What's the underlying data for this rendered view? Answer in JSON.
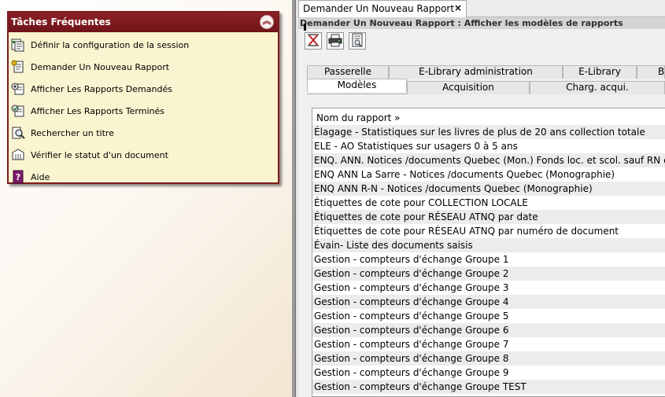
{
  "tasks_panel": {
    "title": "Tâches Fréquentes",
    "collapse_glyph": "︽",
    "items": [
      {
        "label": "Définir la configuration de la session",
        "icon": "session-config-icon"
      },
      {
        "label": "Demander Un Nouveau Rapport",
        "icon": "new-report-icon"
      },
      {
        "label": "Afficher Les Rapports Demandés",
        "icon": "requested-reports-icon"
      },
      {
        "label": "Afficher Les Rapports Terminés",
        "icon": "finished-reports-icon"
      },
      {
        "label": "Rechercher un titre",
        "icon": "search-title-icon"
      },
      {
        "label": "Vérifier le statut d'un document",
        "icon": "document-status-icon"
      },
      {
        "label": "Aide",
        "icon": "help-icon"
      }
    ]
  },
  "doc_tab": {
    "label": "Demander Un Nouveau Rapport",
    "close_glyph": "×"
  },
  "title_bar": {
    "text": "Demander Un Nouveau Rapport : Afficher les modèles de rapports"
  },
  "toolbar": {
    "buttons": [
      {
        "icon": "schedule-report-icon"
      },
      {
        "icon": "printer-icon"
      },
      {
        "icon": "report-template-icon"
      }
    ]
  },
  "subtabs": {
    "row_back": [
      "Passerelle",
      "E-Library administration",
      "E-Library",
      "Bu"
    ],
    "row_front": [
      "Modèles",
      "Acquisition",
      "Charg. acqui."
    ],
    "active": "Modèles"
  },
  "report_list": {
    "header": "Nom du rapport »",
    "rows": [
      "Élagage - Statistiques sur les livres de plus de 20 ans collection totale",
      "ELE - AO Statistiques sur usagers 0 à 5 ans",
      "ENQ. ANN. Notices /documents Quebec (Mon.) Fonds loc. et scol. sauf RN et LS",
      "ENQ ANN La Sarre - Notices /documents Quebec (Monographie)",
      "ENQ ANN R-N - Notices /documents Quebec (Monographie)",
      "Étiquettes de cote pour COLLECTION LOCALE",
      "Étiquettes de cote pour RÉSEAU ATNQ par date",
      "Étiquettes de cote pour RÉSEAU ATNQ par numéro de document",
      "Évain- Liste des documents saisis",
      "Gestion - compteurs d'échange Groupe 1",
      "Gestion - compteurs d'échange Groupe 2",
      "Gestion - compteurs d'échange Groupe 3",
      "Gestion - compteurs d'échange Groupe 4",
      "Gestion - compteurs d'échange Groupe 5",
      "Gestion - compteurs d'échange Groupe 6",
      "Gestion - compteurs d'échange Groupe 7",
      "Gestion - compteurs d'échange Groupe 8",
      "Gestion - compteurs d'échange Groupe 9",
      "Gestion - compteurs d'échange Groupe TEST"
    ]
  }
}
